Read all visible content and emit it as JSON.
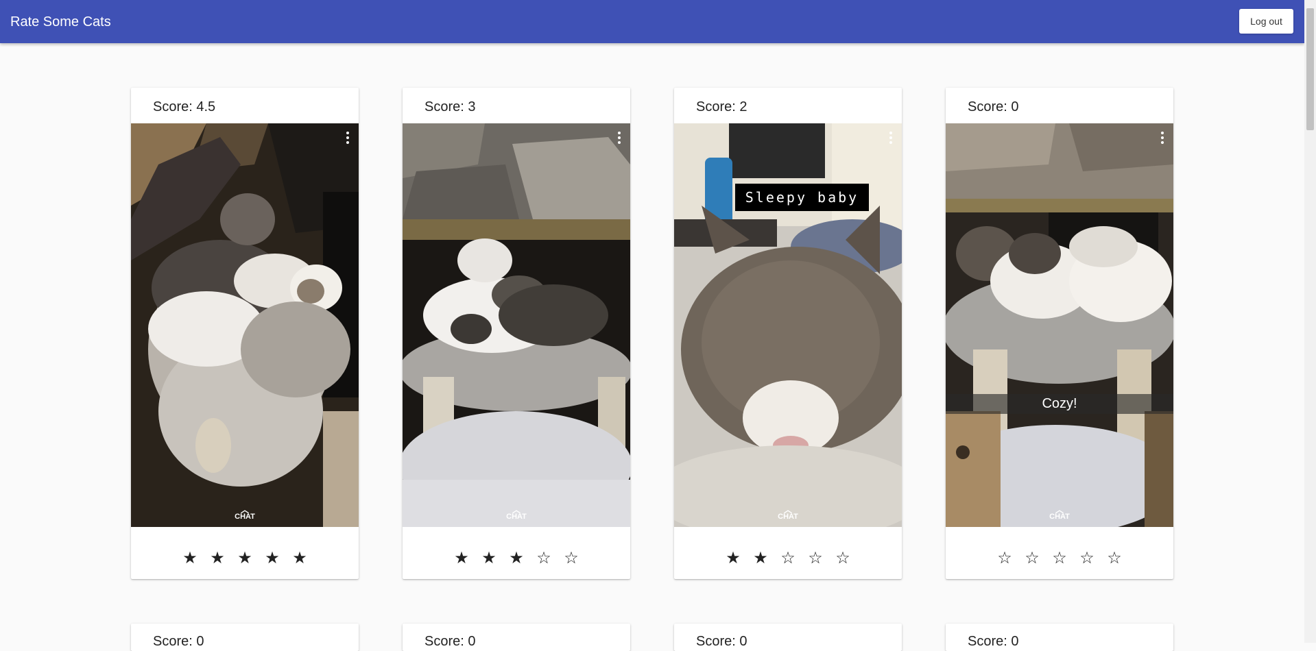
{
  "app": {
    "title": "Rate Some Cats",
    "logout_label": "Log out"
  },
  "icons": {
    "filled_star": "★",
    "empty_star": "☆",
    "more": "more-vert-icon",
    "chat": "chat-icon"
  },
  "watermark": {
    "chat": "CHAT",
    "caret": "︿"
  },
  "cards": [
    {
      "score_text": "Score: 4.5",
      "rating": 5,
      "caption": "",
      "caption_style": "none",
      "stars": [
        "★",
        "★",
        "★",
        "★",
        "★"
      ]
    },
    {
      "score_text": "Score: 3",
      "rating": 3,
      "caption": "",
      "caption_style": "none",
      "stars": [
        "★",
        "★",
        "★",
        "☆",
        "☆"
      ]
    },
    {
      "score_text": "Score: 2",
      "rating": 2,
      "caption": "Sleepy baby",
      "caption_style": "box",
      "stars": [
        "★",
        "★",
        "☆",
        "☆",
        "☆"
      ]
    },
    {
      "score_text": "Score: 0",
      "rating": 0,
      "caption": "Cozy!",
      "caption_style": "bar",
      "stars": [
        "☆",
        "☆",
        "☆",
        "☆",
        "☆"
      ]
    }
  ],
  "next_row": [
    {
      "score_text": "Score: 0"
    },
    {
      "score_text": "Score: 0"
    },
    {
      "score_text": "Score: 0"
    },
    {
      "score_text": "Score: 0"
    }
  ],
  "colors": {
    "appbar": "#3f51b5",
    "background": "#fafafa",
    "star": "#222222"
  }
}
